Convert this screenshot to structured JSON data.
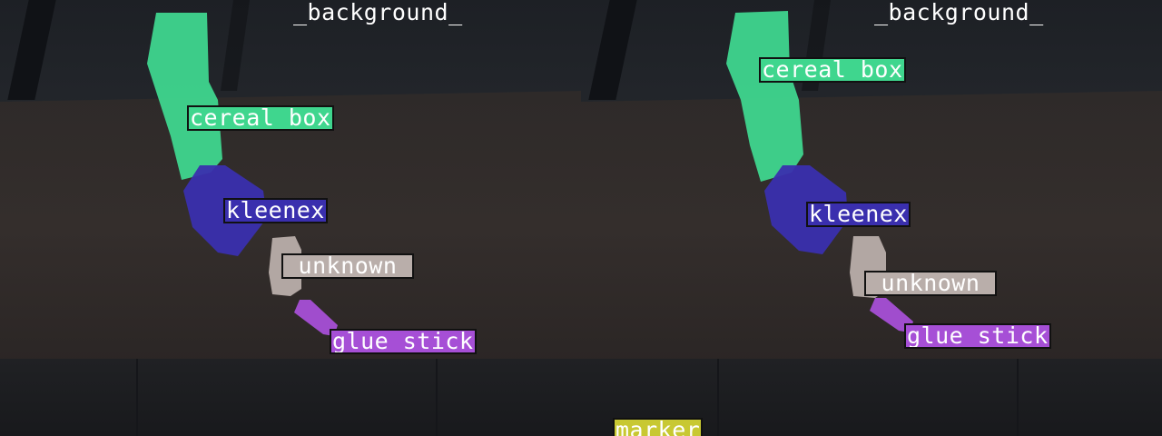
{
  "panels": [
    {
      "labels": {
        "background": "_background_",
        "cereal_box": "cereal_box",
        "kleenex": "kleenex",
        "unknown": "_unknown_",
        "glue_stick": "glue_stick"
      }
    },
    {
      "labels": {
        "background": "_background_",
        "cereal_box": "cereal_box",
        "kleenex": "kleenex",
        "unknown": "_unknown_",
        "glue_stick": "glue_stick",
        "marker": "marker"
      }
    }
  ],
  "colors": {
    "cereal_box": "#3fd68e",
    "kleenex": "#3a2fae",
    "unknown": "#b9aeaa",
    "glue_stick": "#a64fd6",
    "marker": "#c8c832"
  }
}
